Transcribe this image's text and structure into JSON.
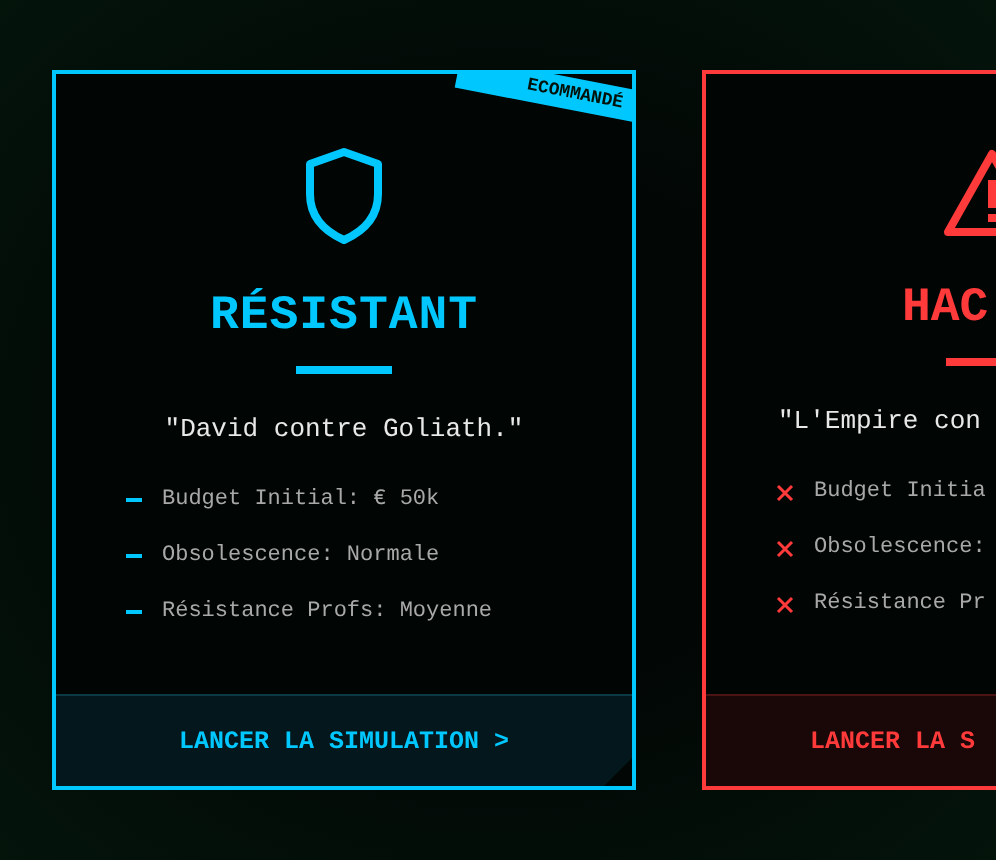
{
  "cards": [
    {
      "kind": "shield",
      "color": "#00c8ff",
      "cut": false,
      "ribbon": "ECOMMANDÉ",
      "title": "RÉSISTANT",
      "quote": "\"David contre Goliath.\"",
      "items": [
        "Budget Initial: € 50k",
        "Obsolescence: Normale",
        "Résistance Profs: Moyenne"
      ],
      "button": "LANCER LA SIMULATION >"
    },
    {
      "kind": "warning",
      "color": "#ff3a3a",
      "cut": true,
      "title": "HAC",
      "quote": "\"L'Empire con",
      "items": [
        "Budget Initia",
        "Obsolescence:",
        "Résistance Pr"
      ],
      "button": "LANCER LA S"
    }
  ]
}
